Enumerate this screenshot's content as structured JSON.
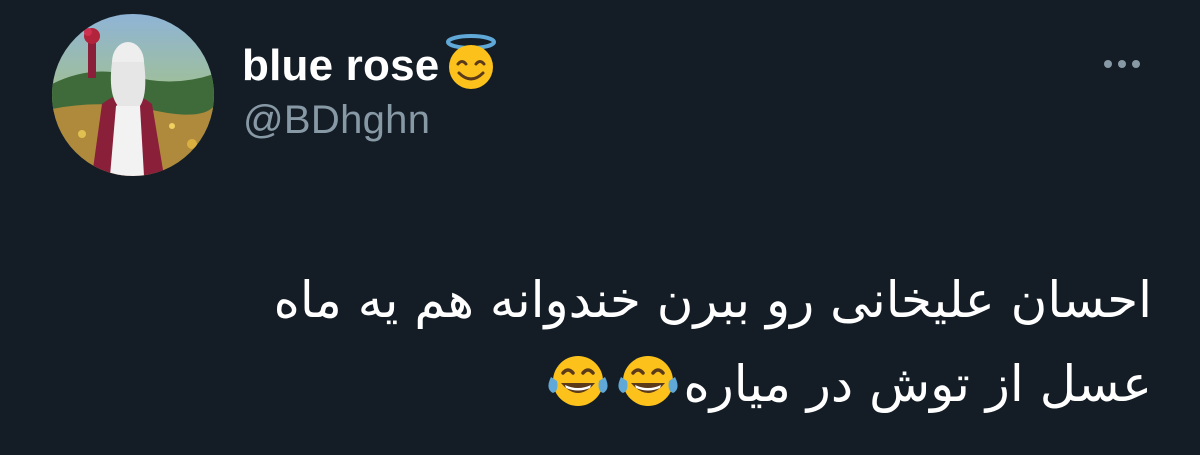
{
  "tweet": {
    "display_name": "blue rose",
    "name_emoji": "smiling-face-with-halo-icon",
    "handle": "@BDhghn",
    "text_lines": [
      "احسان علیخانی رو ببرن خندوانه  هم یه ماه",
      "عسل از توش در میاره"
    ],
    "trailing_emojis": [
      "face-with-tears-of-joy-icon",
      "face-with-tears-of-joy-icon"
    ]
  },
  "colors": {
    "background": "#141d26",
    "text_primary": "#ffffff",
    "text_secondary": "#8899a6",
    "emoji_yellow": "#fcc21b",
    "halo_blue": "#5fa8d8"
  }
}
